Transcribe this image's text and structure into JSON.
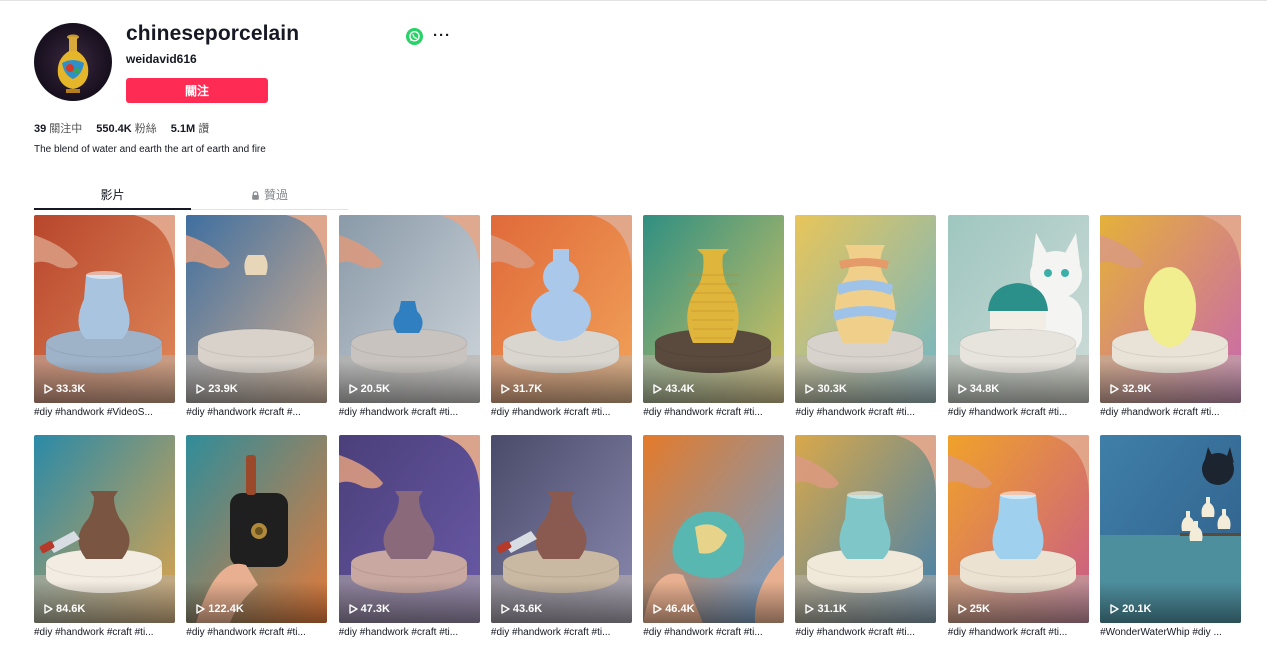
{
  "profile": {
    "username": "chineseporcelain",
    "nickname": "weidavid616",
    "follow_label": "關注",
    "bio": "The blend of water and earth the art of earth and fire",
    "stats": [
      {
        "value": "39",
        "label": "關注中"
      },
      {
        "value": "550.4K",
        "label": "粉絲"
      },
      {
        "value": "5.1M",
        "label": "讚"
      }
    ],
    "more_label": "···",
    "icons": {
      "avatar": "porcelain-vase-avatar",
      "share": "whatsapp-icon",
      "more": "more-options-icon",
      "lock": "lock-icon",
      "play": "play-icon"
    },
    "colors": {
      "brand": "#fe2c55",
      "whatsapp": "#25d366"
    }
  },
  "tabs": {
    "videos": "影片",
    "liked": "贊過"
  },
  "videos": [
    {
      "views": "33.3K",
      "caption": "#diy #handwork #VideoS..."
    },
    {
      "views": "23.9K",
      "caption": "#diy #handwork #craft #..."
    },
    {
      "views": "20.5K",
      "caption": "#diy #handwork #craft #ti..."
    },
    {
      "views": "31.7K",
      "caption": "#diy #handwork #craft #ti..."
    },
    {
      "views": "43.4K",
      "caption": "#diy #handwork #craft #ti..."
    },
    {
      "views": "30.3K",
      "caption": "#diy #handwork #craft #ti..."
    },
    {
      "views": "34.8K",
      "caption": "#diy #handwork #craft #ti..."
    },
    {
      "views": "32.9K",
      "caption": "#diy #handwork #craft #ti..."
    },
    {
      "views": "84.6K",
      "caption": "#diy #handwork #craft #ti..."
    },
    {
      "views": "122.4K",
      "caption": "#diy #handwork #craft #ti..."
    },
    {
      "views": "47.3K",
      "caption": "#diy #handwork #craft #ti..."
    },
    {
      "views": "43.6K",
      "caption": "#diy #handwork #craft #ti..."
    },
    {
      "views": "46.4K",
      "caption": "#diy #handwork #craft #ti..."
    },
    {
      "views": "31.1K",
      "caption": "#diy #handwork #craft #ti..."
    },
    {
      "views": "25K",
      "caption": "#diy #handwork #craft #ti..."
    },
    {
      "views": "20.1K",
      "caption": "#WonderWaterWhip #diy ..."
    }
  ]
}
